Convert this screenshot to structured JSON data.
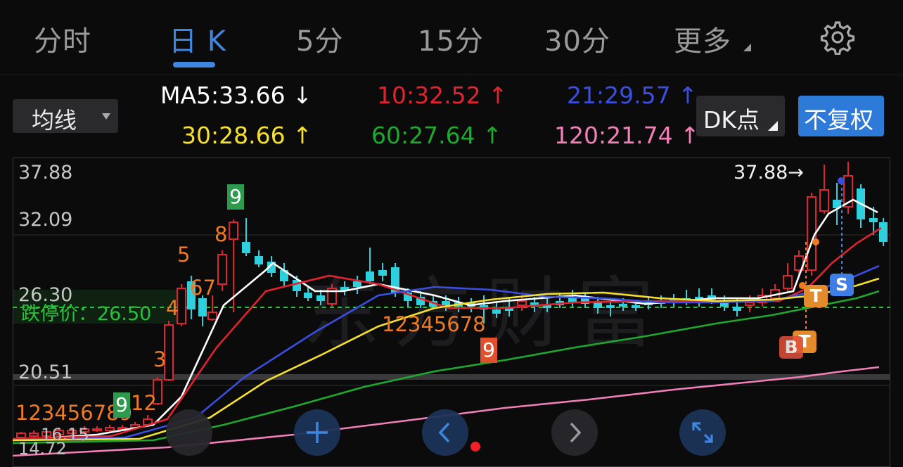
{
  "tabs": [
    {
      "label": "分时",
      "active": false
    },
    {
      "label": "日 K",
      "active": true
    },
    {
      "label": "5分",
      "active": false
    },
    {
      "label": "15分",
      "active": false
    },
    {
      "label": "30分",
      "active": false
    },
    {
      "label": "更多",
      "active": false
    }
  ],
  "settings_icon": "gear-icon",
  "ma_selector": {
    "label": "均线"
  },
  "ma_values": {
    "ma5": "MA5:33.66 ↓",
    "ma10": "10:32.52 ↑",
    "ma21": "21:29.57 ↑",
    "ma30": "30:28.66 ↑",
    "ma60": "60:27.64 ↑",
    "ma120": "120:21.74 ↑"
  },
  "colors": {
    "ma5": "#ffffff",
    "ma10": "#e0232e",
    "ma21": "#3a4fe0",
    "ma30": "#f5e12c",
    "ma60": "#1fa82e",
    "ma120": "#f27fb8",
    "up": "#e0232e",
    "down": "#2fd0dd",
    "accent": "#3f86e0",
    "seq": "#ef7a22",
    "limit": "#28c23a"
  },
  "dk_button": {
    "label": "DK点"
  },
  "fq_button": {
    "label": "不复权"
  },
  "axis": {
    "y_top": "37.88",
    "y_2": "32.09",
    "y_3": "26.30",
    "y_4": "20.51",
    "low_left": "16.15",
    "low_min": "14.72"
  },
  "limit_down": {
    "label": "跌停价：26.50"
  },
  "high_note": "37.88→",
  "watermark": "东方财富",
  "sequences": {
    "early": "123456789",
    "early_tail": "12",
    "rise_3": "3",
    "rise_4": "4",
    "rise_5": "5",
    "rise_67": "67",
    "rise_8": "8",
    "rise_9": "9",
    "mid": "12345678",
    "mid_9": "9"
  },
  "markers": {
    "t1": "T",
    "t2": "T",
    "b": "B",
    "s": "S"
  },
  "nav": [
    "prev-pan-icon",
    "plus-icon",
    "chevron-left-icon",
    "chevron-right-icon",
    "fullscreen-icon"
  ]
}
